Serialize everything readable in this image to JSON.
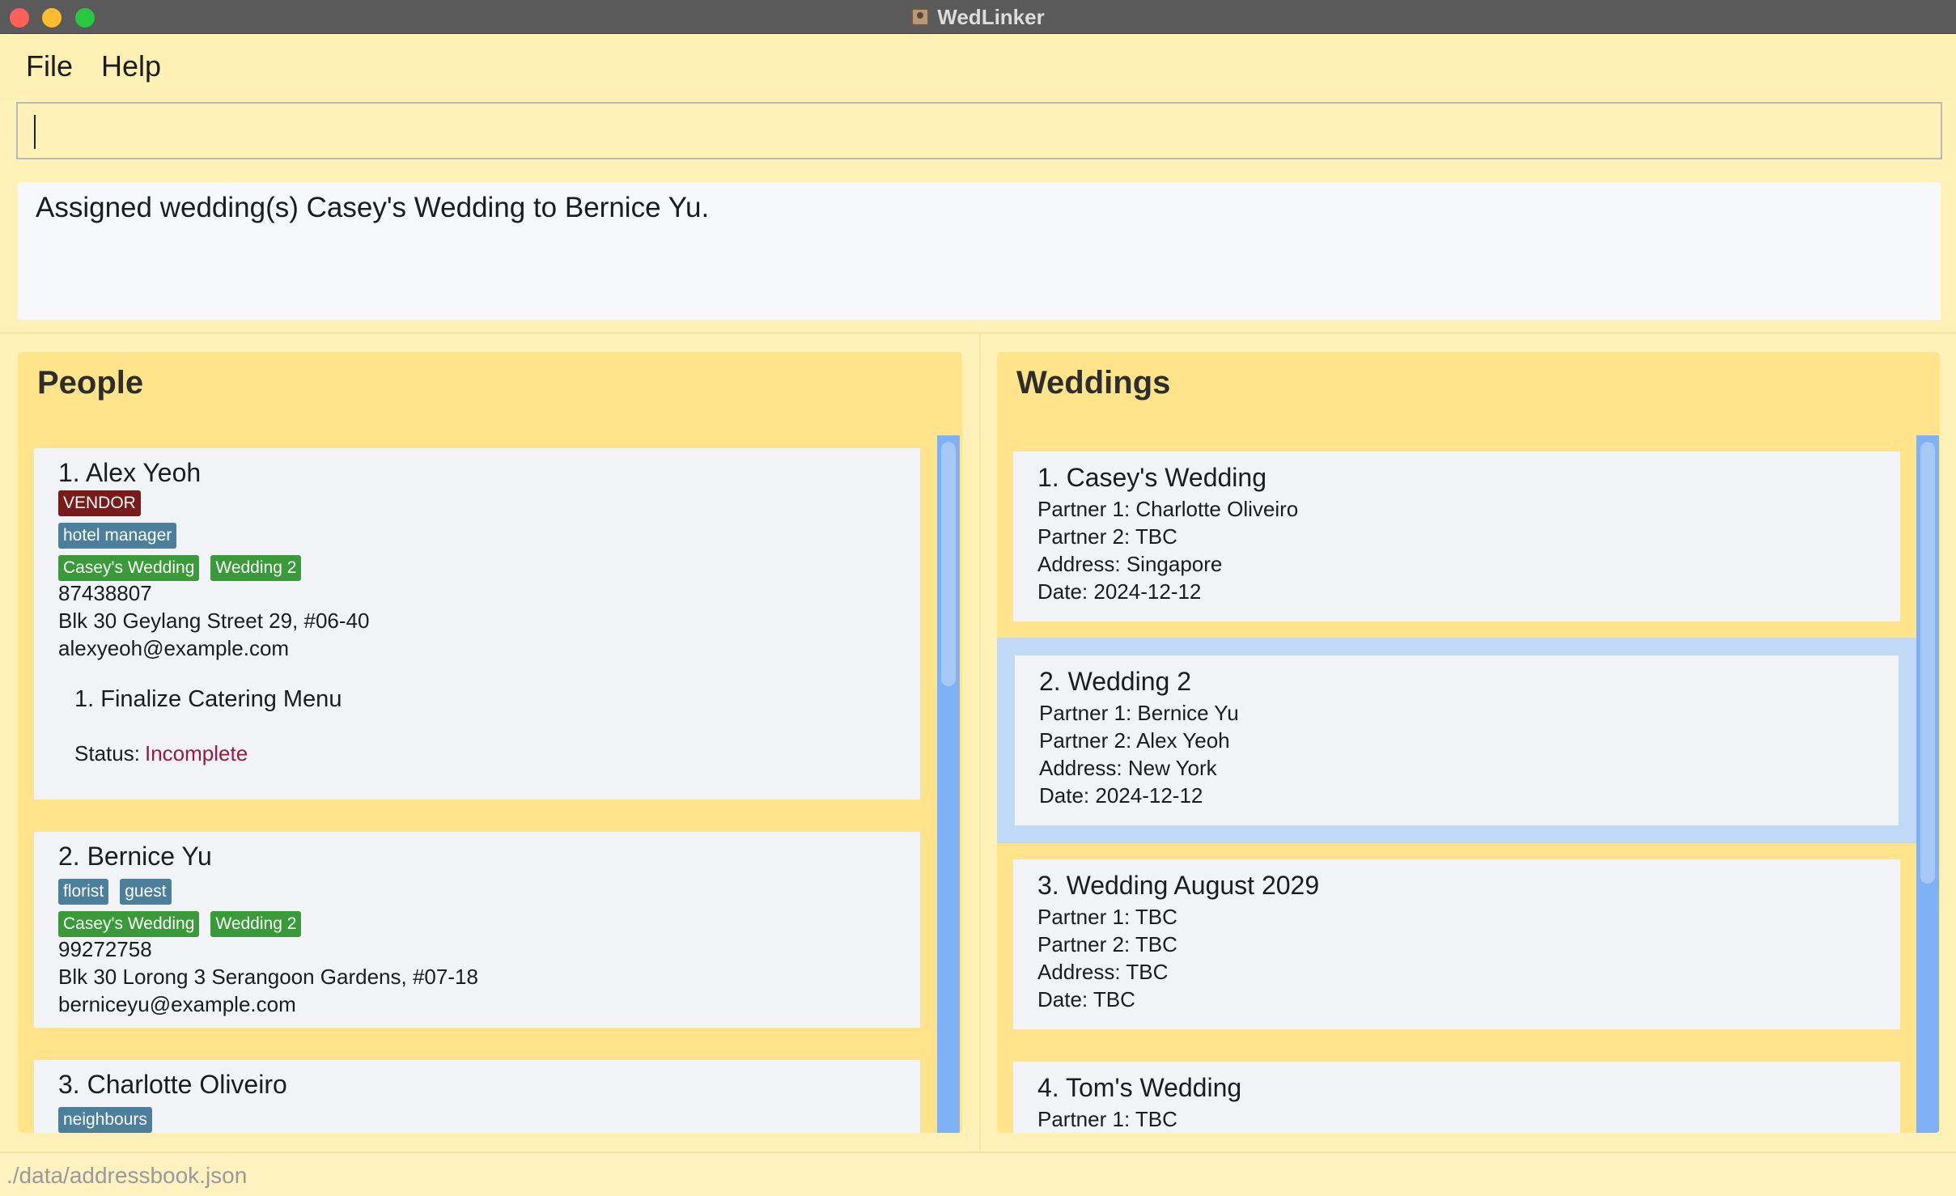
{
  "window": {
    "title": "WedLinker"
  },
  "menu": {
    "file": "File",
    "help": "Help"
  },
  "command": {
    "value": ""
  },
  "result": {
    "message": "Assigned wedding(s) Casey's Wedding to Bernice Yu."
  },
  "people": {
    "title": "People",
    "items": [
      {
        "name": "1. Alex Yeoh",
        "role": "VENDOR",
        "tags": [
          "hotel manager"
        ],
        "weddings": [
          "Casey's Wedding",
          "Wedding 2"
        ],
        "phone": "87438807",
        "address": "Blk 30 Geylang Street 29, #06-40",
        "email": "alexyeoh@example.com",
        "task": "1.  Finalize Catering Menu",
        "status_label": "Status:",
        "status_value": "Incomplete"
      },
      {
        "name": "2. Bernice Yu",
        "tags": [
          "florist",
          "guest"
        ],
        "weddings": [
          "Casey's Wedding",
          "Wedding 2"
        ],
        "phone": "99272758",
        "address": "Blk 30 Lorong 3 Serangoon Gardens, #07-18",
        "email": "berniceyu@example.com"
      },
      {
        "name": "3. Charlotte Oliveiro",
        "tags": [
          "neighbours"
        ]
      }
    ]
  },
  "weddings": {
    "title": "Weddings",
    "items": [
      {
        "name": "1. Casey's Wedding",
        "partner1": "Partner 1: Charlotte Oliveiro",
        "partner2": "Partner 2: TBC",
        "address": "Address: Singapore",
        "date": "Date: 2024-12-12"
      },
      {
        "name": "2. Wedding 2",
        "partner1": "Partner 1: Bernice Yu",
        "partner2": "Partner 2: Alex Yeoh",
        "address": "Address: New York",
        "date": "Date: 2024-12-12",
        "selected": true
      },
      {
        "name": "3. Wedding August 2029",
        "partner1": "Partner 1: TBC",
        "partner2": "Partner 2: TBC",
        "address": "Address: TBC",
        "date": "Date: TBC"
      },
      {
        "name": "4. Tom's Wedding",
        "partner1": "Partner 1: TBC"
      }
    ]
  },
  "status_bar": {
    "path": "./data/addressbook.json"
  },
  "colors": {
    "background": "#fff1b8",
    "panel": "#ffe48c",
    "card": "#f1f3f6",
    "selection": "#c0d9f7",
    "scrollbar": "#7fb1f7",
    "vendor_tag": "#7a1b1b",
    "tag": "#4b7f9c",
    "wedding_tag": "#3a9a3a",
    "incomplete": "#9b1b3a"
  }
}
